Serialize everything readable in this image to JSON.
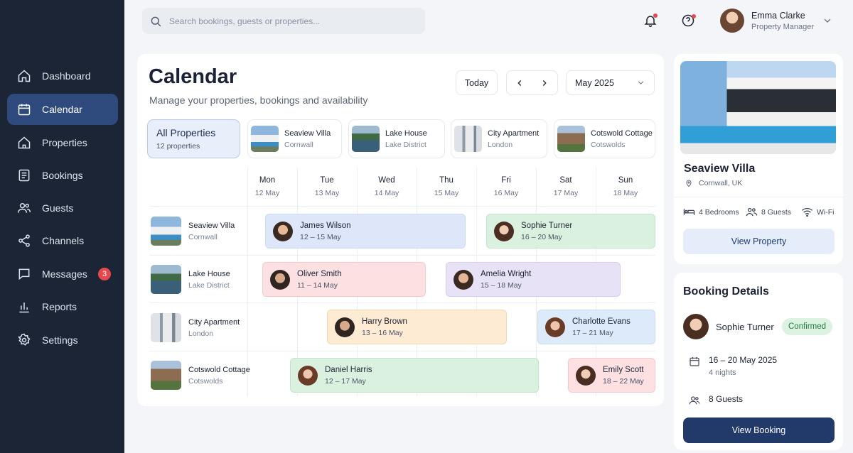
{
  "sidebar": {
    "items": [
      {
        "label": "Dashboard",
        "icon": "home-icon"
      },
      {
        "label": "Calendar",
        "icon": "calendar-icon",
        "active": true
      },
      {
        "label": "Properties",
        "icon": "house-icon"
      },
      {
        "label": "Bookings",
        "icon": "document-icon"
      },
      {
        "label": "Guests",
        "icon": "users-icon"
      },
      {
        "label": "Channels",
        "icon": "share-icon"
      },
      {
        "label": "Messages",
        "icon": "chat-icon",
        "badge": "3"
      },
      {
        "label": "Reports",
        "icon": "bar-chart-icon"
      },
      {
        "label": "Settings",
        "icon": "gear-icon"
      }
    ]
  },
  "header": {
    "search_placeholder": "Search bookings, guests or properties...",
    "user": {
      "name": "Emma Clarke",
      "role": "Property Manager"
    }
  },
  "calendar": {
    "title": "Calendar",
    "subtitle": "Manage your properties, bookings and availability",
    "today_label": "Today",
    "month": "May 2025",
    "all_properties": {
      "label": "All Properties",
      "count": "12 properties"
    },
    "properties": [
      {
        "name": "Seaview Villa",
        "location": "Cornwall"
      },
      {
        "name": "Lake House",
        "location": "Lake District"
      },
      {
        "name": "City Apartment",
        "location": "London"
      },
      {
        "name": "Cotswold Cottage",
        "location": "Cotswolds"
      }
    ],
    "days": [
      {
        "name": "Mon",
        "date": "12 May"
      },
      {
        "name": "Tue",
        "date": "13 May"
      },
      {
        "name": "Wed",
        "date": "14 May"
      },
      {
        "name": "Thu",
        "date": "15 May"
      },
      {
        "name": "Fri",
        "date": "16 May"
      },
      {
        "name": "Sat",
        "date": "17 May"
      },
      {
        "name": "Sun",
        "date": "18 May"
      }
    ],
    "bookings": [
      {
        "guest": "James Wilson",
        "dates": "12 – 15 May",
        "color": "#dde7f9"
      },
      {
        "guest": "Sophie Turner",
        "dates": "16 – 20 May",
        "color": "#dbf1df"
      },
      {
        "guest": "Oliver Smith",
        "dates": "11 – 14 May",
        "color": "#fde0e1"
      },
      {
        "guest": "Amelia Wright",
        "dates": "15 – 18 May",
        "color": "#e8e2f7"
      },
      {
        "guest": "Harry Brown",
        "dates": "13 – 16 May",
        "color": "#fdebd4"
      },
      {
        "guest": "Charlotte Evans",
        "dates": "17 – 21 May",
        "color": "#dceaf9"
      },
      {
        "guest": "Daniel Harris",
        "dates": "12 – 17 May",
        "color": "#dbf1df"
      },
      {
        "guest": "Emily Scott",
        "dates": "18 – 22 May",
        "color": "#fde0e1"
      }
    ]
  },
  "property_panel": {
    "name": "Seaview Villa",
    "location": "Cornwall, UK",
    "bedrooms": "4 Bedrooms",
    "guests": "8 Guests",
    "wifi": "Wi-Fi",
    "button": "View Property"
  },
  "booking_details": {
    "title": "Booking Details",
    "guest": "Sophie Turner",
    "status": "Confirmed",
    "status_color": "#1f7a3a",
    "dates": "16 – 20 May 2025",
    "nights": "4 nights",
    "guests": "8 Guests",
    "button": "View Booking"
  },
  "colors": {
    "sidebar_bg": "#1b2536",
    "accent": "#213a6a",
    "active_nav": "#2f4a7c",
    "badge": "#e5484d"
  }
}
